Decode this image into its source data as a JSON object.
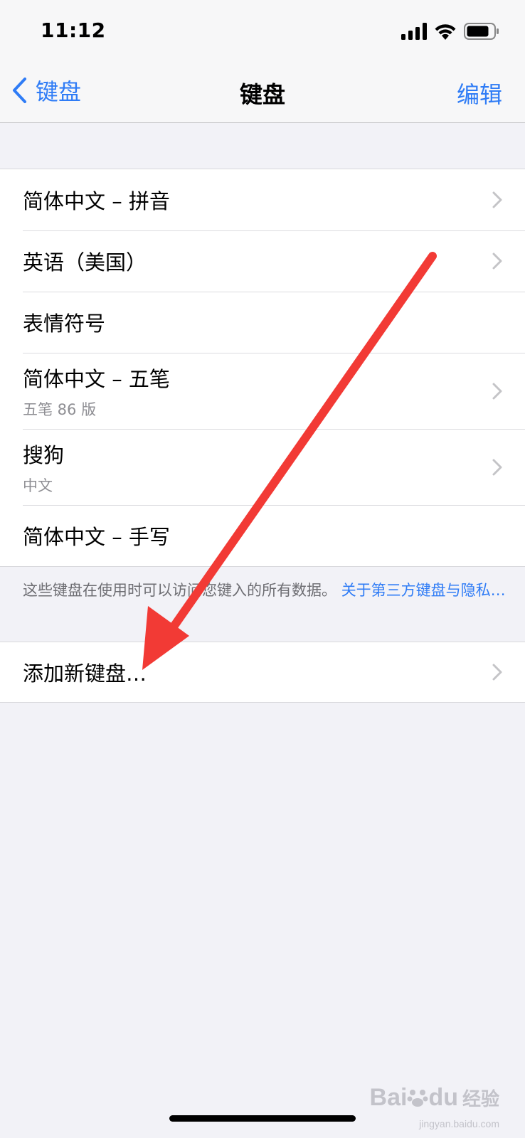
{
  "status_bar": {
    "time": "11:12",
    "icons": [
      "cellular-signal-icon",
      "wifi-icon",
      "battery-icon"
    ]
  },
  "nav": {
    "back_label": "键盘",
    "title": "键盘",
    "edit_label": "编辑"
  },
  "keyboards": [
    {
      "label": "简体中文 – 拼音",
      "subtitle": "",
      "chevron": true
    },
    {
      "label": "英语（美国）",
      "subtitle": "",
      "chevron": true
    },
    {
      "label": "表情符号",
      "subtitle": "",
      "chevron": false
    },
    {
      "label": "简体中文 – 五笔",
      "subtitle": "五笔 86 版",
      "chevron": true
    },
    {
      "label": "搜狗",
      "subtitle": "中文",
      "chevron": true
    },
    {
      "label": "简体中文 – 手写",
      "subtitle": "",
      "chevron": false
    }
  ],
  "footer": {
    "note": "这些键盘在使用时可以访问您键入的所有数据。",
    "link": "关于第三方键盘与隐私…"
  },
  "add_keyboard": {
    "label": "添加新键盘…"
  },
  "watermark": {
    "brand": "Bai",
    "brand2": "du",
    "cn": "经验",
    "url": "jingyan.baidu.com"
  },
  "colors": {
    "accent": "#2f7cf6",
    "background": "#f2f2f7",
    "annotation_arrow": "#f23a35"
  }
}
